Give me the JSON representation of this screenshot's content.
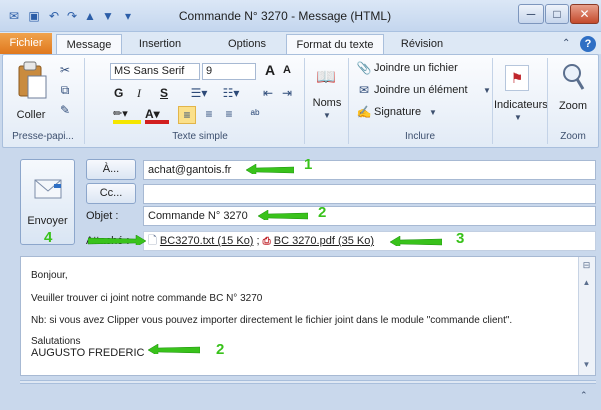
{
  "window": {
    "title": "Commande N° 3270 - Message (HTML)",
    "minimize": "─",
    "maximize": "□",
    "close": "✕"
  },
  "quick_access": [
    "✉",
    "▣",
    "↶",
    "↷",
    "▲",
    "▼",
    "▾"
  ],
  "tabs": [
    {
      "label": "Fichier"
    },
    {
      "label": "Message"
    },
    {
      "label": "Insertion"
    },
    {
      "label": "Options"
    },
    {
      "label": "Format du texte"
    },
    {
      "label": "Révision"
    }
  ],
  "ribbon": {
    "paste_label": "Coller",
    "font_name": "MS Sans Serif",
    "font_size": "9",
    "grow_font": "A",
    "shrink_font": "A",
    "bold": "G",
    "italic": "I",
    "underline": "S",
    "names_label": "Noms",
    "attach_file": "Joindre un fichier",
    "attach_item": "Joindre un élément",
    "signature": "Signature",
    "indicators_label": "Indicateurs",
    "zoom_label": "Zoom",
    "groups": {
      "clipboard": "Presse-papi...",
      "basic_text": "Texte simple",
      "include": "Inclure",
      "zoom": "Zoom"
    }
  },
  "header": {
    "send_label": "Envoyer",
    "to_button": "À...",
    "cc_button": "Cc...",
    "subject_label": "Objet :",
    "attached_label": "Attaché :",
    "to_value": "achat@gantois.fr",
    "cc_value": "",
    "subject_value": "Commande N° 3270",
    "attachments": [
      {
        "name": "BC3270.txt (15 Ko)",
        "icon": "txt-file-icon"
      },
      {
        "name": "BC 3270.pdf (35 Ko)",
        "icon": "pdf-file-icon"
      }
    ]
  },
  "body": {
    "greeting": "Bonjour,",
    "line1": "Veuiller trouver ci joint notre commande BC N° 3270",
    "line2": "Nb: si vous avez Clipper vous pouvez importer directement le fichier joint dans le module  \"commande client\".",
    "closing": "Salutations",
    "signature": "AUGUSTO FREDERIC"
  },
  "annotations": {
    "n1": "1",
    "n2": "2",
    "n3": "3",
    "n4": "4",
    "n5": "2",
    "color": "#39c21b"
  }
}
